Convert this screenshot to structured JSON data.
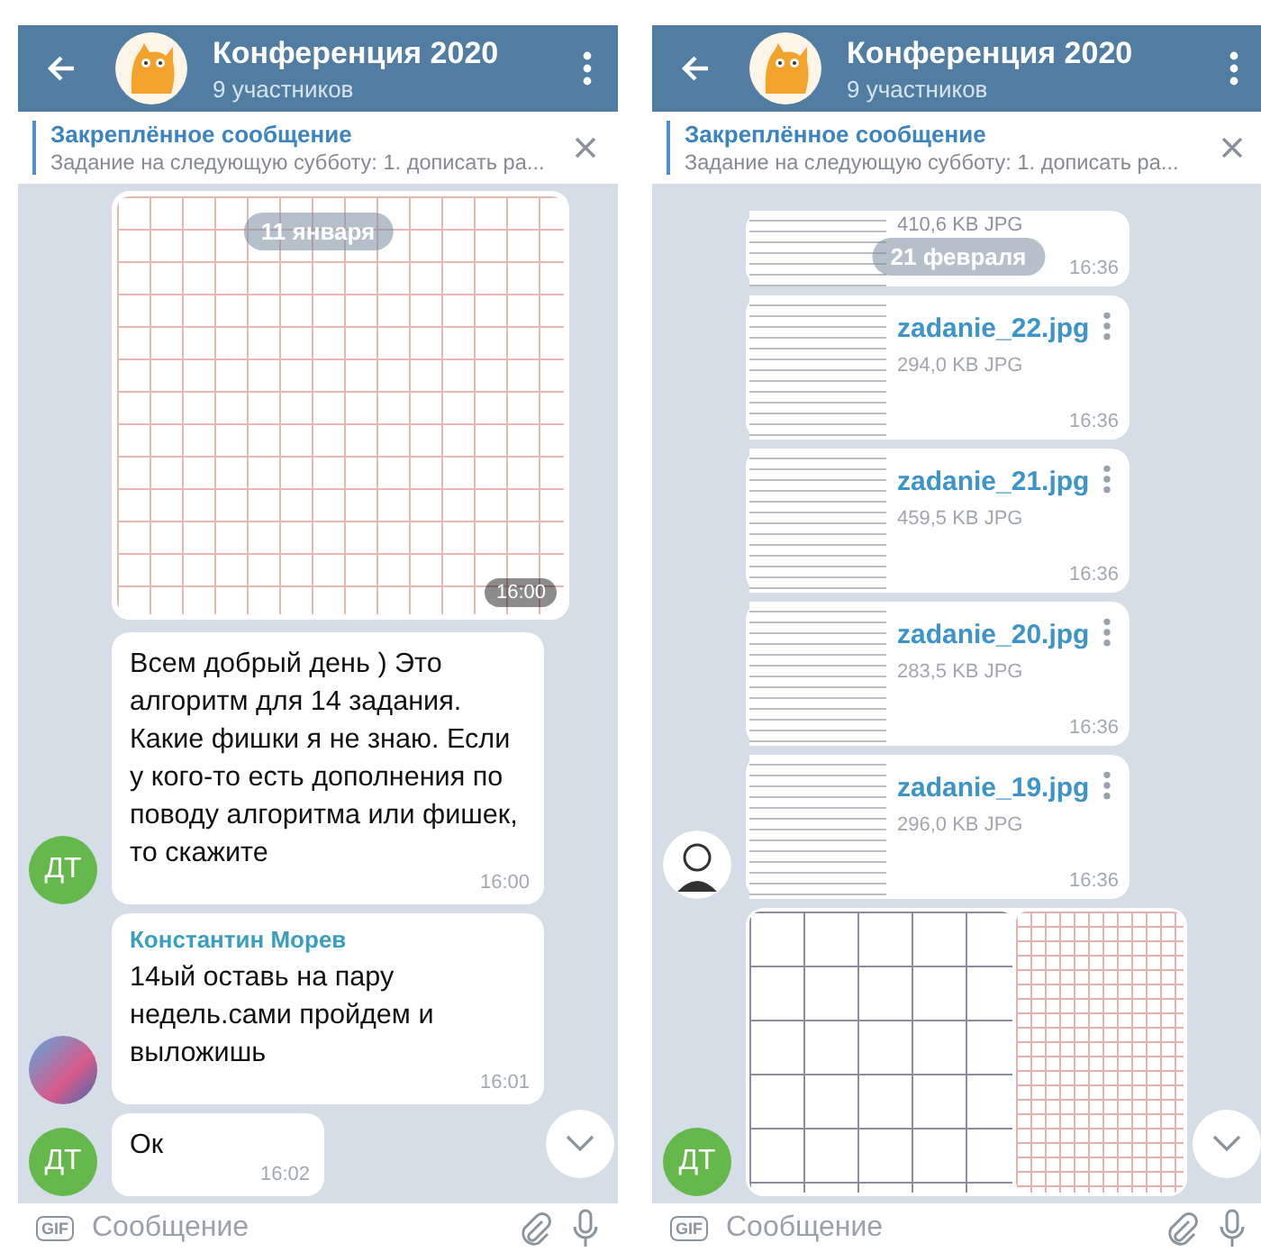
{
  "screens": [
    {
      "header": {
        "title": "Конференция 2020",
        "subtitle": "9 участников"
      },
      "pinned": {
        "label": "Закреплённое сообщение",
        "text": "Задание на следующую субботу: 1. дописать ра..."
      },
      "date_pill": "11 января",
      "messages": [
        {
          "kind": "photo",
          "time": "16:00"
        },
        {
          "kind": "text",
          "text": "Всем добрый день ) Это алгоритм для 14 задания. Какие фишки я не знаю. Если у кого-то есть дополнения по поводу алгоритма или фишек, то скажите",
          "time": "16:00",
          "avatar": {
            "kind": "initials",
            "text": "ДТ"
          }
        },
        {
          "kind": "text",
          "sender": "Константин Морев",
          "text": "14ый оставь на пару недель.сами пройдем и выложишь",
          "time": "16:01",
          "avatar": {
            "kind": "photo"
          }
        },
        {
          "kind": "text",
          "text": "Ок",
          "time": "16:02",
          "avatar": {
            "kind": "initials",
            "text": "ДТ"
          }
        }
      ],
      "input": {
        "gif": "GIF",
        "placeholder": "Сообщение"
      }
    },
    {
      "header": {
        "title": "Конференция 2020",
        "subtitle": "9 участников"
      },
      "pinned": {
        "label": "Закреплённое сообщение",
        "text": "Задание на следующую субботу: 1. дописать ра..."
      },
      "date_pill": "21 февраля",
      "messages": [
        {
          "kind": "file_tail",
          "size": "410,6 KB JPG",
          "time": "16:36"
        },
        {
          "kind": "file",
          "name": "zadanie_22.jpg",
          "size": "294,0 KB JPG",
          "time": "16:36"
        },
        {
          "kind": "file",
          "name": "zadanie_21.jpg",
          "size": "459,5 KB JPG",
          "time": "16:36"
        },
        {
          "kind": "file",
          "name": "zadanie_20.jpg",
          "size": "283,5 KB JPG",
          "time": "16:36"
        },
        {
          "kind": "file",
          "name": "zadanie_19.jpg",
          "size": "296,0 KB JPG",
          "time": "16:36",
          "avatar": {
            "kind": "sketch"
          }
        },
        {
          "kind": "album",
          "avatar": {
            "kind": "initials",
            "text": "ДТ"
          }
        }
      ],
      "input": {
        "gif": "GIF",
        "placeholder": "Сообщение"
      }
    }
  ]
}
